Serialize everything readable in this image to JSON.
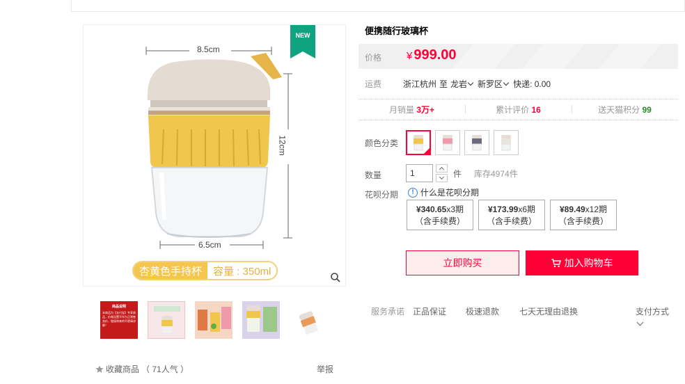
{
  "product": {
    "title": "便携随行玻璃杯",
    "new_badge": "NEW",
    "dims": {
      "top": "8.5cm",
      "side": "12cm",
      "bottom": "6.5cm"
    },
    "caption_a": "杏黄色手持杯",
    "caption_b": "容量 : 350ml",
    "thumb1_title": "商品说明",
    "thumb1_text": "本商品为【支付宝】专享商品，价格设置不作为正常售卖价，链接带来的不便请谅解！"
  },
  "favorite": {
    "label": "收藏商品",
    "count": "（ 71人气 ）"
  },
  "report_label": "举报",
  "price": {
    "label": "价格",
    "currency": "¥",
    "value": "999.00"
  },
  "shipping": {
    "label": "运费",
    "from": "浙江杭州",
    "to_word": "至",
    "city": "龙岩",
    "district": "新罗区",
    "express": "快递: 0.00"
  },
  "stats": {
    "monthly_label": "月销量",
    "monthly_value": "3万+",
    "reviews_label": "累计评价",
    "reviews_value": "16",
    "points_label": "送天猫积分",
    "points_value": "99"
  },
  "color": {
    "label": "颜色分类",
    "options": [
      "yellow",
      "pink",
      "gray",
      "white"
    ],
    "selected": 0
  },
  "quantity": {
    "label": "数量",
    "value": "1",
    "unit": "件",
    "stock": "库存4974件"
  },
  "huabei": {
    "label": "花呗分期",
    "question": "什么是花呗分期",
    "plans": [
      {
        "amount": "¥340.65",
        "terms": "x3期",
        "note": "（含手续费）"
      },
      {
        "amount": "¥173.99",
        "terms": "x6期",
        "note": "（含手续费）"
      },
      {
        "amount": "¥89.49",
        "terms": "x12期",
        "note": "（含手续费）"
      }
    ]
  },
  "actions": {
    "buy_now": "立即购买",
    "add_cart": "加入购物车"
  },
  "service": {
    "label": "服务承诺",
    "items": [
      "正品保证",
      "极速退款",
      "七天无理由退换"
    ],
    "pay_label": "支付方式"
  },
  "colors": {
    "accent": "#ff0036",
    "points": "#2a8a2a",
    "badge": "#10a37f"
  }
}
